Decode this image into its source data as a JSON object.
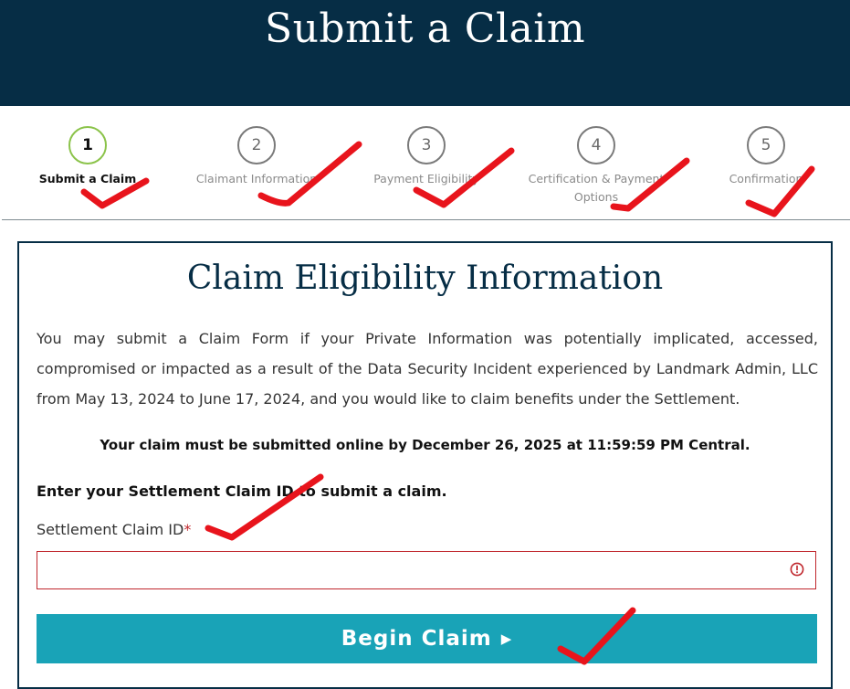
{
  "header": {
    "title": "Submit a Claim"
  },
  "stepper": {
    "steps": [
      {
        "number": "1",
        "label": "Submit a Claim",
        "active": true
      },
      {
        "number": "2",
        "label": "Claimant Information",
        "active": false
      },
      {
        "number": "3",
        "label": "Payment Eligibility",
        "active": false
      },
      {
        "number": "4",
        "label": "Certification & Payment Options",
        "active": false
      },
      {
        "number": "5",
        "label": "Confirmation",
        "active": false
      }
    ]
  },
  "card": {
    "title": "Claim Eligibility Information",
    "intro": "You may submit a Claim Form if your Private Information was potentially implicated, accessed, compromised or impacted as a result of the Data Security Incident experienced by Landmark Admin, LLC from May 13, 2024 to June 17, 2024, and you would like to claim benefits under the Settlement.",
    "deadline": "Your claim must be submitted online by December 26, 2025 at 11:59:59 PM Central.",
    "enter_prompt": "Enter your Settlement Claim ID to submit a claim.",
    "field_label": "Settlement Claim ID",
    "required_marker": "*",
    "field_value": "",
    "button_label": "Begin Claim",
    "button_icon": "caret-right-icon"
  },
  "colors": {
    "header_bg": "#062d45",
    "active_step_ring": "#8bc34a",
    "button_bg": "#19a3b7",
    "error": "#c0272d",
    "annotation_marks": "#e8141c"
  }
}
